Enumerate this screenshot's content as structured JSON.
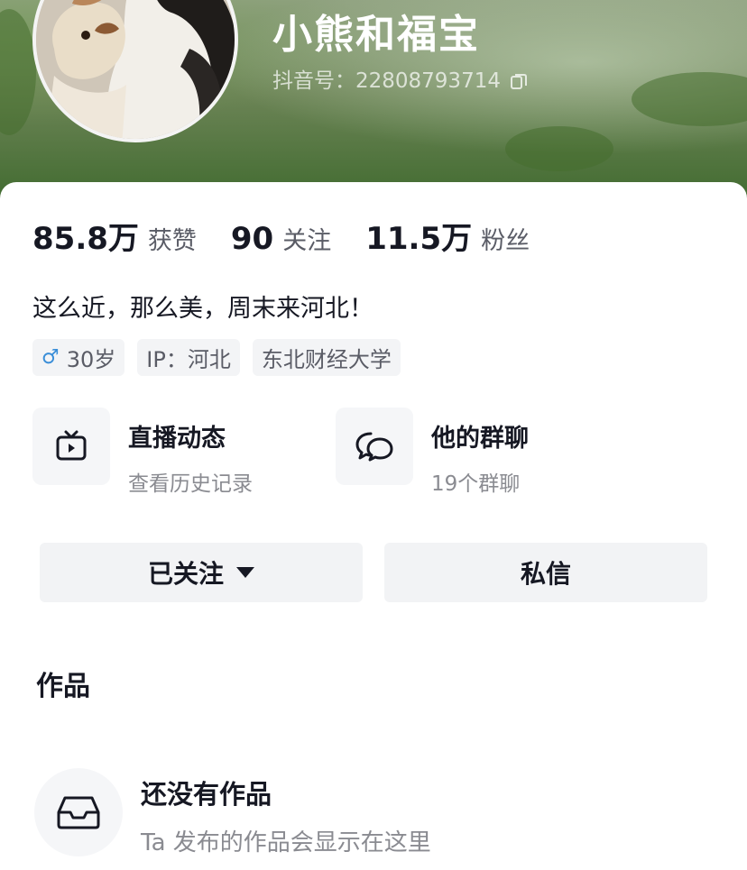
{
  "profile": {
    "name": "小熊和福宝",
    "douyin_id_label": "抖音号：",
    "douyin_id": "22808793714"
  },
  "stats": [
    {
      "value": "85.8万",
      "label": "获赞"
    },
    {
      "value": "90",
      "label": "关注"
    },
    {
      "value": "11.5万",
      "label": "粉丝"
    }
  ],
  "bio": "这么近，那么美，周末来河北！",
  "tags": {
    "age": "30岁",
    "ip": "IP：河北",
    "school": "东北财经大学"
  },
  "features": {
    "live": {
      "title": "直播动态",
      "subtitle": "查看历史记录",
      "icon": "tv-icon"
    },
    "groups": {
      "title": "他的群聊",
      "subtitle": "19个群聊",
      "icon": "chat-bubbles-icon"
    }
  },
  "actions": {
    "follow_label": "已关注",
    "message_label": "私信"
  },
  "works": {
    "section_title": "作品",
    "empty_title": "还没有作品",
    "empty_subtitle": "Ta 发布的作品会显示在这里",
    "icon": "inbox-tray-icon"
  },
  "colors": {
    "header_green": "#4f7a3a",
    "gender_blue": "#3a8ed8",
    "text_primary": "#161823",
    "text_secondary": "#8a8b91"
  }
}
